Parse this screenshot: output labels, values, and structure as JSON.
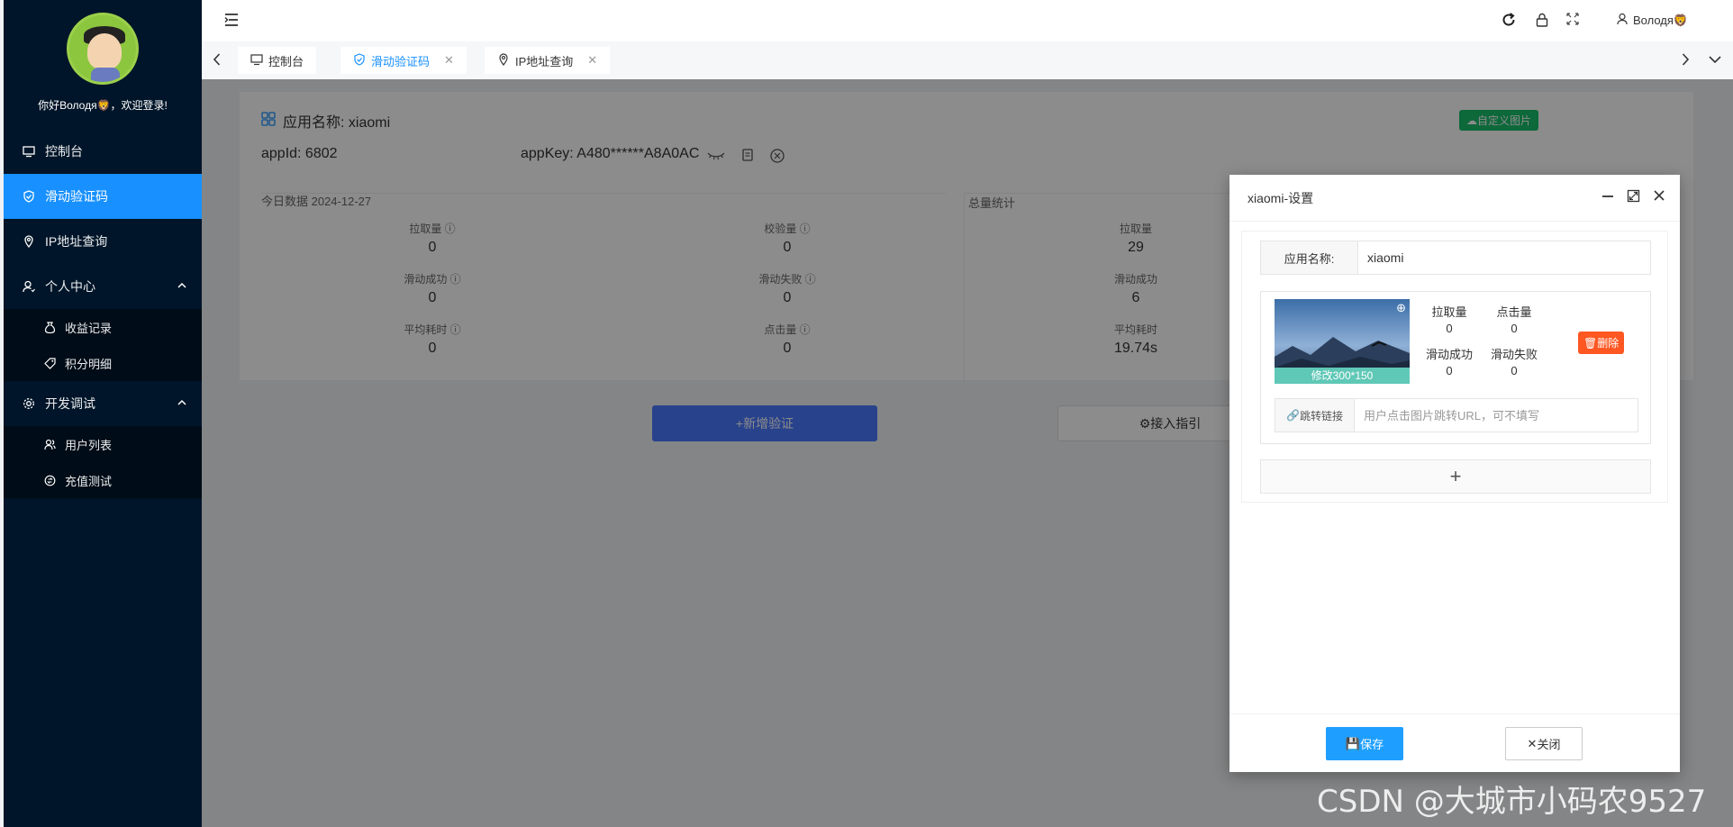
{
  "sidebar": {
    "greeting": "你好Володя🦁，欢迎登录!",
    "menu": [
      {
        "label": "控制台"
      },
      {
        "label": "滑动验证码"
      },
      {
        "label": "IP地址查询"
      },
      {
        "label": "个人中心"
      },
      {
        "label": "收益记录"
      },
      {
        "label": "积分明细"
      },
      {
        "label": "开发调试"
      },
      {
        "label": "用户列表"
      },
      {
        "label": "充值测试"
      }
    ]
  },
  "header": {
    "username": "Володя🦁"
  },
  "tabs": [
    {
      "label": "控制台"
    },
    {
      "label": "滑动验证码"
    },
    {
      "label": "IP地址查询"
    }
  ],
  "app": {
    "title": "应用名称: xiaomi",
    "custom_image_btn": "自定义图片",
    "appid": "appId: 6802",
    "appkey": "appKey: A480******A8A0AC"
  },
  "today": {
    "heading": "今日数据 2024-12-27",
    "stats": [
      {
        "label": "拉取量",
        "value": "0"
      },
      {
        "label": "校验量",
        "value": "0"
      },
      {
        "label": "滑动成功",
        "value": "0"
      },
      {
        "label": "滑动失败",
        "value": "0"
      },
      {
        "label": "平均耗时",
        "value": "0"
      },
      {
        "label": "点击量",
        "value": "0"
      }
    ]
  },
  "total": {
    "heading": "总量统计",
    "stats": [
      {
        "label": "拉取量",
        "value": "29"
      },
      {
        "label": "滑动成功",
        "value": "6"
      },
      {
        "label": "平均耗时",
        "value": "19.74s"
      }
    ]
  },
  "actions": {
    "add": "+新增验证",
    "guide": "接入指引"
  },
  "modal": {
    "title": "xiaomi-设置",
    "name_label": "应用名称:",
    "name_value": "xiaomi",
    "image_caption": "修改300*150",
    "image_stats": [
      {
        "label": "拉取量",
        "value": "0"
      },
      {
        "label": "点击量",
        "value": "0"
      },
      {
        "label": "滑动成功",
        "value": "0"
      },
      {
        "label": "滑动失败",
        "value": "0"
      }
    ],
    "delete_label": "删除",
    "link_label": "跳转链接",
    "link_placeholder": "用户点击图片跳转URL，可不填写",
    "add_label": "+",
    "save_label": "保存",
    "close_label": "关闭"
  },
  "watermark": "CSDN @大城市小码农9527"
}
